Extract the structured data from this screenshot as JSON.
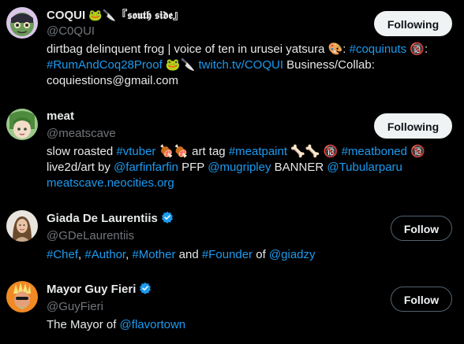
{
  "users": [
    {
      "name": "COQUI",
      "name_suffix": "🐸🔪『𝖘𝖔𝖚𝖙𝖍 𝖘𝖎𝖉𝖊』",
      "handle": "@C0QUI",
      "button": "Following",
      "bio": {
        "t1": "dirtbag delinquent frog | voice of ten in urusei yatsura 🎨: ",
        "l1": "#coquinuts",
        "t2": " 🔞: ",
        "l2": "#RumAndCoq28Proof",
        "t3": " 🐸🔪 ",
        "l3": "twitch.tv/COQUI",
        "t4": " Business/Collab: coquiestions@gmail.com"
      }
    },
    {
      "name": "meat",
      "handle": "@meatscave",
      "button": "Following",
      "bio": {
        "t1": "slow roasted ",
        "l1": "#vtuber",
        "t2": " 🍖🍖 art tag ",
        "l2": "#meatpaint",
        "t3": " 🦴🦴 🔞 ",
        "l3": "#meatboned",
        "t4": " 🔞 live2d/art by ",
        "l4": "@farfinfarfin",
        "t5": " PFP ",
        "l5": "@mugripley",
        "t6": " BANNER ",
        "l6": "@Tubularparu",
        "l7": "meatscave.neocities.org"
      }
    },
    {
      "name": "Giada De Laurentiis",
      "handle": "@GDeLaurentiis",
      "button": "Follow",
      "bio": {
        "l1": "#Chef",
        "t1": ", ",
        "l2": "#Author",
        "t2": ", ",
        "l3": "#Mother",
        "t3": " and ",
        "l4": "#Founder",
        "t4": " of ",
        "l5": "@giadzy"
      }
    },
    {
      "name": "Mayor Guy Fieri",
      "handle": "@GuyFieri",
      "button": "Follow",
      "bio": {
        "t1": "The Mayor of ",
        "l1": "@flavortown"
      }
    }
  ],
  "colors": {
    "background": "#000000",
    "text": "#e7e9ea",
    "muted": "#71767b",
    "link": "#1d9bf0",
    "verified": "#1d9bf0"
  }
}
